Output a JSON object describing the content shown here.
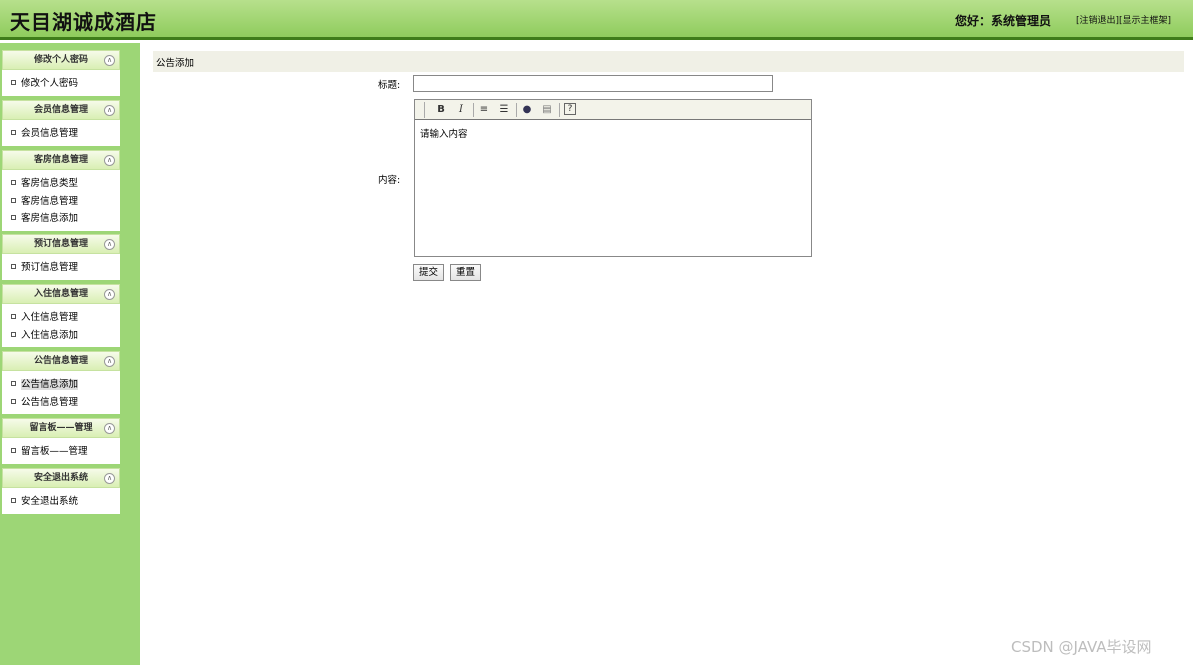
{
  "header": {
    "site_title": "天目湖诚成酒店",
    "greeting": "您好：系统管理员",
    "logout_link": "[注销退出]",
    "frame_link": "[显示主框架]"
  },
  "sidebar": {
    "groups": [
      {
        "title": "修改个人密码",
        "items": [
          "修改个人密码"
        ]
      },
      {
        "title": "会员信息管理",
        "items": [
          "会员信息管理"
        ]
      },
      {
        "title": "客房信息管理",
        "items": [
          "客房信息类型",
          "客房信息管理",
          "客房信息添加"
        ]
      },
      {
        "title": "预订信息管理",
        "items": [
          "预订信息管理"
        ]
      },
      {
        "title": "入住信息管理",
        "items": [
          "入住信息管理",
          "入住信息添加"
        ]
      },
      {
        "title": "公告信息管理",
        "items": [
          "公告信息添加",
          "公告信息管理"
        ]
      },
      {
        "title": "留言板——管理",
        "items": [
          "留言板——管理"
        ]
      },
      {
        "title": "安全退出系统",
        "items": [
          "安全退出系统"
        ]
      }
    ],
    "collapse_glyph": "∧"
  },
  "main": {
    "header": "公告添加",
    "form": {
      "title_label": "标题:",
      "title_value": "",
      "content_label": "内容:",
      "content_value": "请输入内容",
      "submit_label": "提交",
      "reset_label": "重置"
    },
    "toolbar": {
      "bold": "B",
      "italic": "I",
      "ordered_list": "≡",
      "unordered_list": "☰",
      "link": "●",
      "image": "▤",
      "help": "?"
    }
  },
  "watermark": "CSDN @JAVA毕设网"
}
